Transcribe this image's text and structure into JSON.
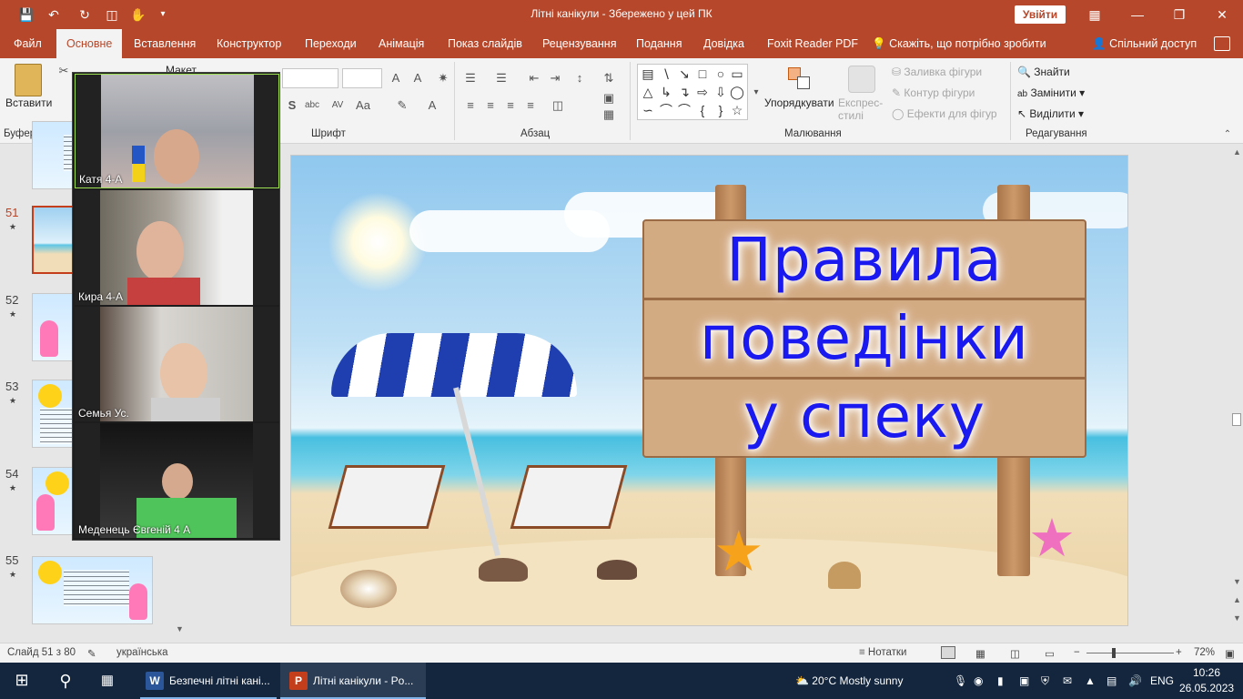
{
  "titlebar": {
    "title": "Літні канікули  -  Збережено у цей ПК",
    "signin_label": "Увійти",
    "icons": [
      "save-icon",
      "undo-icon",
      "redo-icon",
      "present-icon",
      "touch-mode-icon",
      "customize-icon"
    ]
  },
  "tabs": [
    {
      "label": "Файл"
    },
    {
      "label": "Основне"
    },
    {
      "label": "Вставлення"
    },
    {
      "label": "Конструктор"
    },
    {
      "label": "Переходи"
    },
    {
      "label": "Анімація"
    },
    {
      "label": "Показ слайдів"
    },
    {
      "label": "Рецензування"
    },
    {
      "label": "Подання"
    },
    {
      "label": "Довідка"
    },
    {
      "label": "Foxit Reader PDF"
    }
  ],
  "tell_me": "Скажіть, що потрібно зробити",
  "share_label": "Спільний доступ",
  "ribbon": {
    "paste_label": "Вставити",
    "clipboard_label": "Буфер обміну",
    "layout_partial": "Макет",
    "font_label": "Шрифт",
    "paragraph_label": "Абзац",
    "arrange_label": "Упорядкувати",
    "quick_styles_label": "Експрес-стилі",
    "shape_fill": "Заливка фігури",
    "shape_outline": "Контур фігури",
    "shape_effects": "Ефекти для фігур",
    "drawing_label": "Малювання",
    "find_label": "Знайти",
    "replace_label": "Замінити",
    "select_label": "Виділити",
    "editing_label": "Редагування"
  },
  "slides": [
    {
      "number": "51",
      "active": true
    },
    {
      "number": "52",
      "active": false
    },
    {
      "number": "53",
      "active": false
    },
    {
      "number": "54",
      "active": false
    },
    {
      "number": "55",
      "active": false
    }
  ],
  "slide": {
    "title_line1": "Правила",
    "title_line2": "поведінки",
    "title_line3": "у  спеку"
  },
  "zoom": {
    "participants": [
      {
        "name": "Катя  4-А",
        "speaking": true
      },
      {
        "name": "Кира 4-А",
        "speaking": false
      },
      {
        "name": "Семья Ус.",
        "speaking": false
      },
      {
        "name": "Меденець Євгеній 4 А",
        "speaking": false
      }
    ]
  },
  "statusbar": {
    "slide_of": "Слайд 51 з 80",
    "language": "українська",
    "notes_label": "Нотатки",
    "zoom_level": "72%"
  },
  "taskbar": {
    "word_app": "Безпечні літні кані...",
    "ppt_app": "Літні канікули - Po...",
    "weather": "20°C  Mostly sunny",
    "lang": "ENG",
    "time": "10:26",
    "date": "26.05.2023"
  },
  "colors": {
    "accent": "#b7472a",
    "title_text": "#1a1af0",
    "active_slide_border": "#c43e1c",
    "taskbar": "#13263d"
  }
}
